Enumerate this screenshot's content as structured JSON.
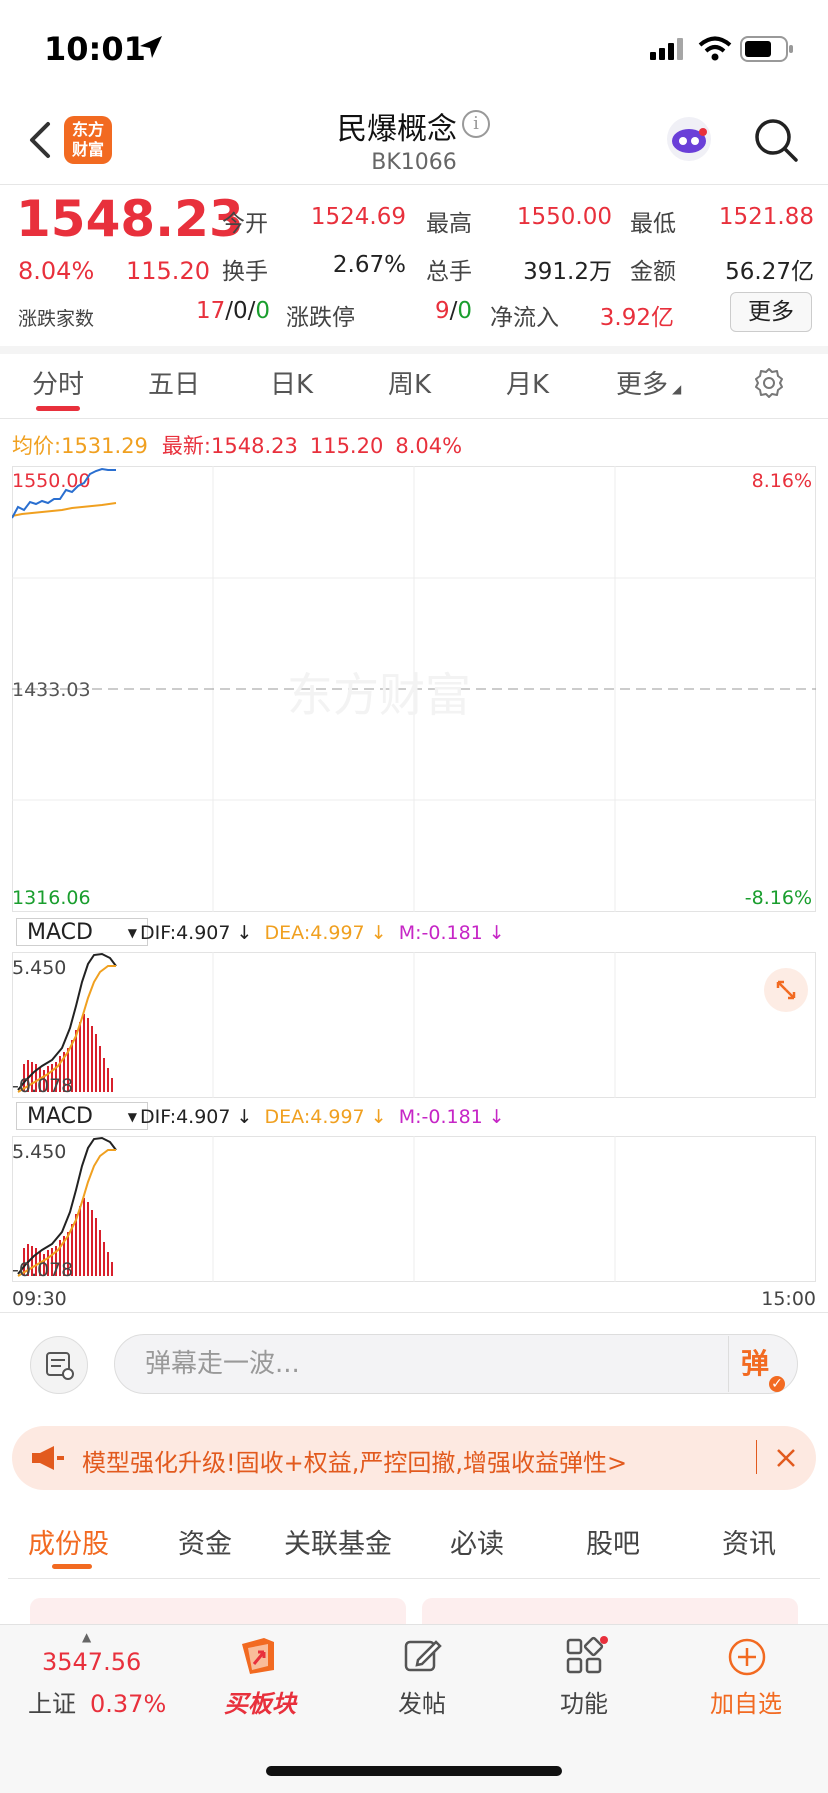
{
  "status_bar": {
    "time": "10:01"
  },
  "nav": {
    "logo_text": "东方财富",
    "title": "民爆概念",
    "code": "BK1066"
  },
  "quote": {
    "price": "1548.23",
    "change_pct": "8.04%",
    "change": "115.20",
    "open_label": "今开",
    "open_value": "1524.69",
    "high_label": "最高",
    "high_value": "1550.00",
    "low_label": "最低",
    "low_value": "1521.88",
    "turnover_label": "换手",
    "turnover_value": "2.67%",
    "volume_label": "总手",
    "volume_value": "391.2万",
    "amount_label": "金额",
    "amount_value": "56.27亿",
    "updown_label": "涨跌家数",
    "updown_up": "17",
    "updown_sep1": "/",
    "updown_flat": "0",
    "updown_sep2": "/",
    "updown_down": "0",
    "limit_label": "涨跌停",
    "limit_up": "9",
    "limit_sep": "/",
    "limit_down": "0",
    "netflow_label": "净流入",
    "netflow_value": "3.92亿",
    "more_button": "更多"
  },
  "period_tabs": [
    {
      "label": "分时",
      "active": true
    },
    {
      "label": "五日"
    },
    {
      "label": "日K"
    },
    {
      "label": "周K"
    },
    {
      "label": "月K"
    },
    {
      "label": "更多"
    }
  ],
  "intraday": {
    "avg_label": "均价:",
    "avg_value": "1531.29",
    "latest_label": "最新:",
    "latest_value": "1548.23",
    "latest_change": "115.20",
    "latest_pct": "8.04%",
    "y_top": "1550.00",
    "y_mid": "1433.03",
    "y_bottom": "1316.06",
    "pct_top": "8.16%",
    "pct_bottom": "-8.16%",
    "watermark": "东方财富",
    "time_start": "09:30",
    "time_end": "15:00"
  },
  "macd": {
    "selector": "MACD",
    "dif": "DIF:4.907",
    "dea": "DEA:4.997",
    "m": "M:-0.181",
    "y_top": "5.450",
    "y_bottom": "-0.078"
  },
  "danmu": {
    "placeholder": "弹幕走一波...",
    "send_label": "弹"
  },
  "banner": {
    "text": "模型强化升级!固收+权益,严控回撤,增强收益弹性>"
  },
  "bottom_tabs": [
    {
      "label": "成份股",
      "active": true
    },
    {
      "label": "资金"
    },
    {
      "label": "关联基金"
    },
    {
      "label": "必读"
    },
    {
      "label": "股吧"
    },
    {
      "label": "资讯"
    }
  ],
  "bottom_bar": {
    "index_value": "3547.56",
    "index_name": "上证",
    "index_pct": "0.37%",
    "buy_label": "买板块",
    "post_label": "发帖",
    "func_label": "功能",
    "add_label": "加自选"
  },
  "colors": {
    "up": "#e8303c",
    "down": "#1a9e2e",
    "accent": "#f26a21",
    "avg": "#f0a020"
  }
}
